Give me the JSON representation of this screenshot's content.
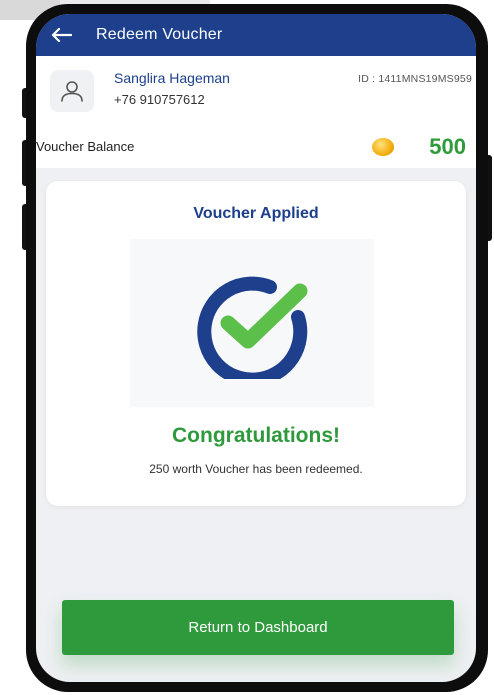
{
  "header": {
    "title": "Redeem Voucher",
    "back_icon": "arrow-left-icon"
  },
  "user": {
    "avatar_icon": "user-icon",
    "name": "Sanglira Hageman",
    "phone": "+76 910757612",
    "id": "ID : 1411MNS19MS959"
  },
  "balance": {
    "label": "Voucher Balance",
    "icon": "coin-icon",
    "value": "500"
  },
  "card": {
    "title": "Voucher Applied",
    "status_icon": "check-circle-icon",
    "congrats": "Congratulations!",
    "message": "250 worth Voucher has been redeemed."
  },
  "actions": {
    "return_label": "Return to Dashboard"
  },
  "colors": {
    "primary": "#1d3f8c",
    "success": "#2f9a3c",
    "check": "#5bbf4a",
    "coin": "#f0a500"
  }
}
